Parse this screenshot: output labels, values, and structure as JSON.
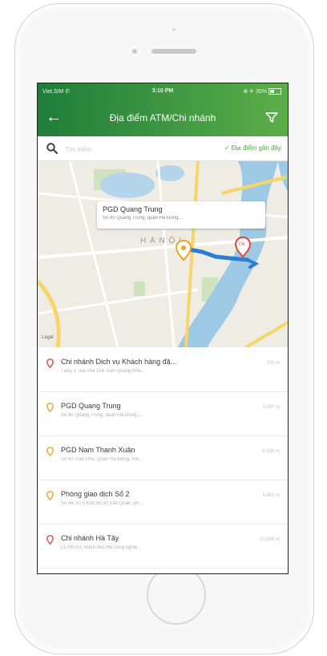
{
  "status_bar": {
    "carrier": "Viet.SIM ✆",
    "time": "3:10 PM",
    "right": "⊕ ✈ 35%"
  },
  "header": {
    "title": "Địa điểm ATM/Chi nhánh"
  },
  "search": {
    "placeholder": "Tìm kiếm",
    "nearby_label": "✓ Địa điểm gần đây"
  },
  "map": {
    "callout_title": "PGD Quang Trung",
    "callout_address": "Số 80 Quang Trung, quận Hà Đông...",
    "city_label": "H À N Ộ I",
    "logo": "Legal",
    "marker_label": "Chi"
  },
  "locations": [
    {
      "name": "Chi nhánh Dịch vụ Khách hàng đặ...",
      "address": "Tầng 3 Tòa nhà 108 Trần Quang Khả...",
      "distance": "101 m",
      "color": "#e0463d"
    },
    {
      "name": "PGD Quang Trung",
      "address": "Số 80 Quang Trung, quận Hà Đông,...",
      "distance": "2,497 m",
      "color": "#f2a31f"
    },
    {
      "name": "PGD Nam Thanh Xuân",
      "address": "Số 91 Trần Phú, Quận Hà Đông, Hà...",
      "distance": "8,936 m",
      "color": "#f2a31f"
    },
    {
      "name": "Phòng giao dịch Số 2",
      "address": "Số 44, BT8 Khu đô thị Văn Quán, ph...",
      "distance": "8,892 m",
      "color": "#f2a31f"
    },
    {
      "name": "Chi nhánh Hà Tây",
      "address": "Lô HH-03, Điểm tiểu thủ công nghiệ...",
      "distance": "10,699 m",
      "color": "#e0463d"
    }
  ],
  "colors": {
    "brand_green": "#2e8b3e",
    "accent_green": "#4fa843",
    "pin_red": "#e0463d",
    "pin_orange": "#f2a31f",
    "route_blue": "#2a7fd1"
  }
}
